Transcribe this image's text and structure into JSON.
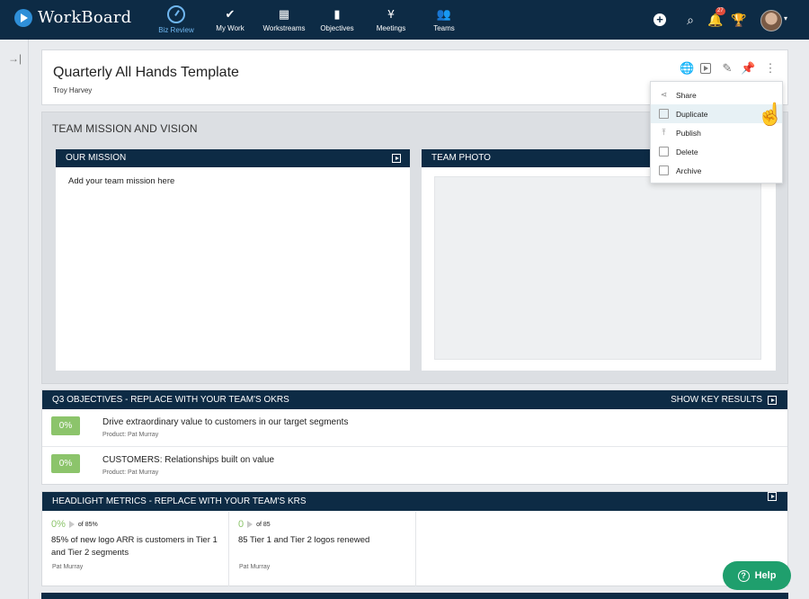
{
  "app": {
    "name": "WorkBoard",
    "nav": [
      {
        "label": "Biz Review",
        "icon": "gauge-icon",
        "active": true
      },
      {
        "label": "My Work",
        "icon": "checkmark-icon",
        "active": false
      },
      {
        "label": "Workstreams",
        "icon": "grid-icon",
        "active": false
      },
      {
        "label": "Objectives",
        "icon": "bar-chart-icon",
        "active": false
      },
      {
        "label": "Meetings",
        "icon": "branch-icon",
        "active": false
      },
      {
        "label": "Teams",
        "icon": "people-icon",
        "active": false
      }
    ],
    "notification_count": "27"
  },
  "page": {
    "title": "Quarterly All Hands Template",
    "owner": "Troy Harvey"
  },
  "menu": {
    "items": [
      {
        "label": "Share",
        "icon": "share-icon"
      },
      {
        "label": "Duplicate",
        "icon": "duplicate-icon"
      },
      {
        "label": "Publish",
        "icon": "publish-icon"
      },
      {
        "label": "Delete",
        "icon": "trash-icon"
      },
      {
        "label": "Archive",
        "icon": "archive-icon"
      }
    ]
  },
  "mission": {
    "section_title": "TEAM MISSION AND VISION",
    "our_mission_title": "OUR MISSION",
    "our_mission_placeholder": "Add your team mission here",
    "team_photo_title": "TEAM PHOTO"
  },
  "objectives": {
    "title": "Q3 OBJECTIVES - REPLACE WITH YOUR TEAM'S OKRS",
    "show_key_results": "SHOW KEY RESULTS",
    "rows": [
      {
        "progress": "0%",
        "name": "Drive extraordinary value to customers in our target segments",
        "meta": "Product: Pat Murray"
      },
      {
        "progress": "0%",
        "name": "CUSTOMERS: Relationships built on value",
        "meta": "Product: Pat Murray"
      }
    ]
  },
  "metrics": {
    "title": "HEADLIGHT METRICS - REPLACE WITH YOUR TEAM'S KRS",
    "items": [
      {
        "value": "0%",
        "target": "of 85%",
        "description": "85% of new logo ARR is customers in Tier 1 and Tier 2 segments",
        "owner": "Pat Murray"
      },
      {
        "value": "0",
        "target": "of 85",
        "description": "85 Tier 1 and Tier 2 logos renewed",
        "owner": "Pat Murray"
      }
    ]
  },
  "help": {
    "label": "Help"
  }
}
